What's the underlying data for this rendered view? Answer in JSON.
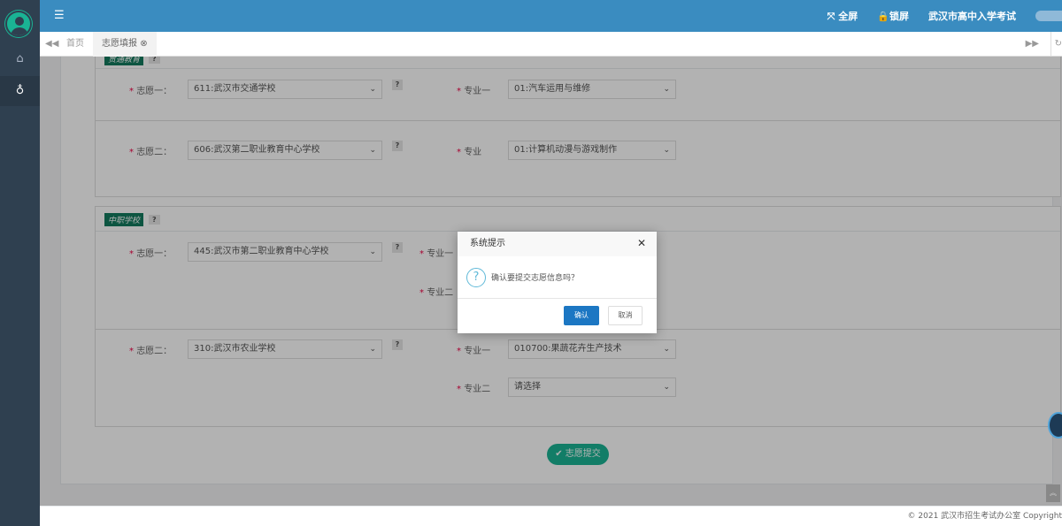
{
  "header": {
    "fullscreen": "全屏",
    "lock": "锁屏",
    "site": "武汉市高中入学考试"
  },
  "tabs": [
    {
      "label": "首页"
    },
    {
      "label": "志愿填报"
    }
  ],
  "sections": [
    {
      "label": "贯通教育",
      "rows": [
        {
          "label": "志愿一：",
          "school": "611:武汉市交通学校",
          "major_label": "专业一",
          "major": "01:汽车运用与维修"
        },
        {
          "label": "志愿二：",
          "school": "606:武汉第二职业教育中心学校",
          "major_label": "专业",
          "major": "01:计算机动漫与游戏制作"
        }
      ]
    },
    {
      "label": "中职学校",
      "rows": [
        {
          "label": "志愿一：",
          "school": "445:武汉市第二职业教育中心学校",
          "major_label": "专业一",
          "major2_label": "专业二"
        },
        {
          "label": "志愿二：",
          "school": "310:武汉市农业学校",
          "major_label": "专业一",
          "major": "010700:果蔬花卉生产技术",
          "major2_label": "专业二",
          "major2": "请选择"
        }
      ]
    }
  ],
  "submit": "志愿提交",
  "dialog": {
    "title": "系统提示",
    "message": "确认要提交志愿信息吗？",
    "ok": "确认",
    "cancel": "取消"
  },
  "footer": "© 2021 武汉市招生考试办公室 Copyright"
}
